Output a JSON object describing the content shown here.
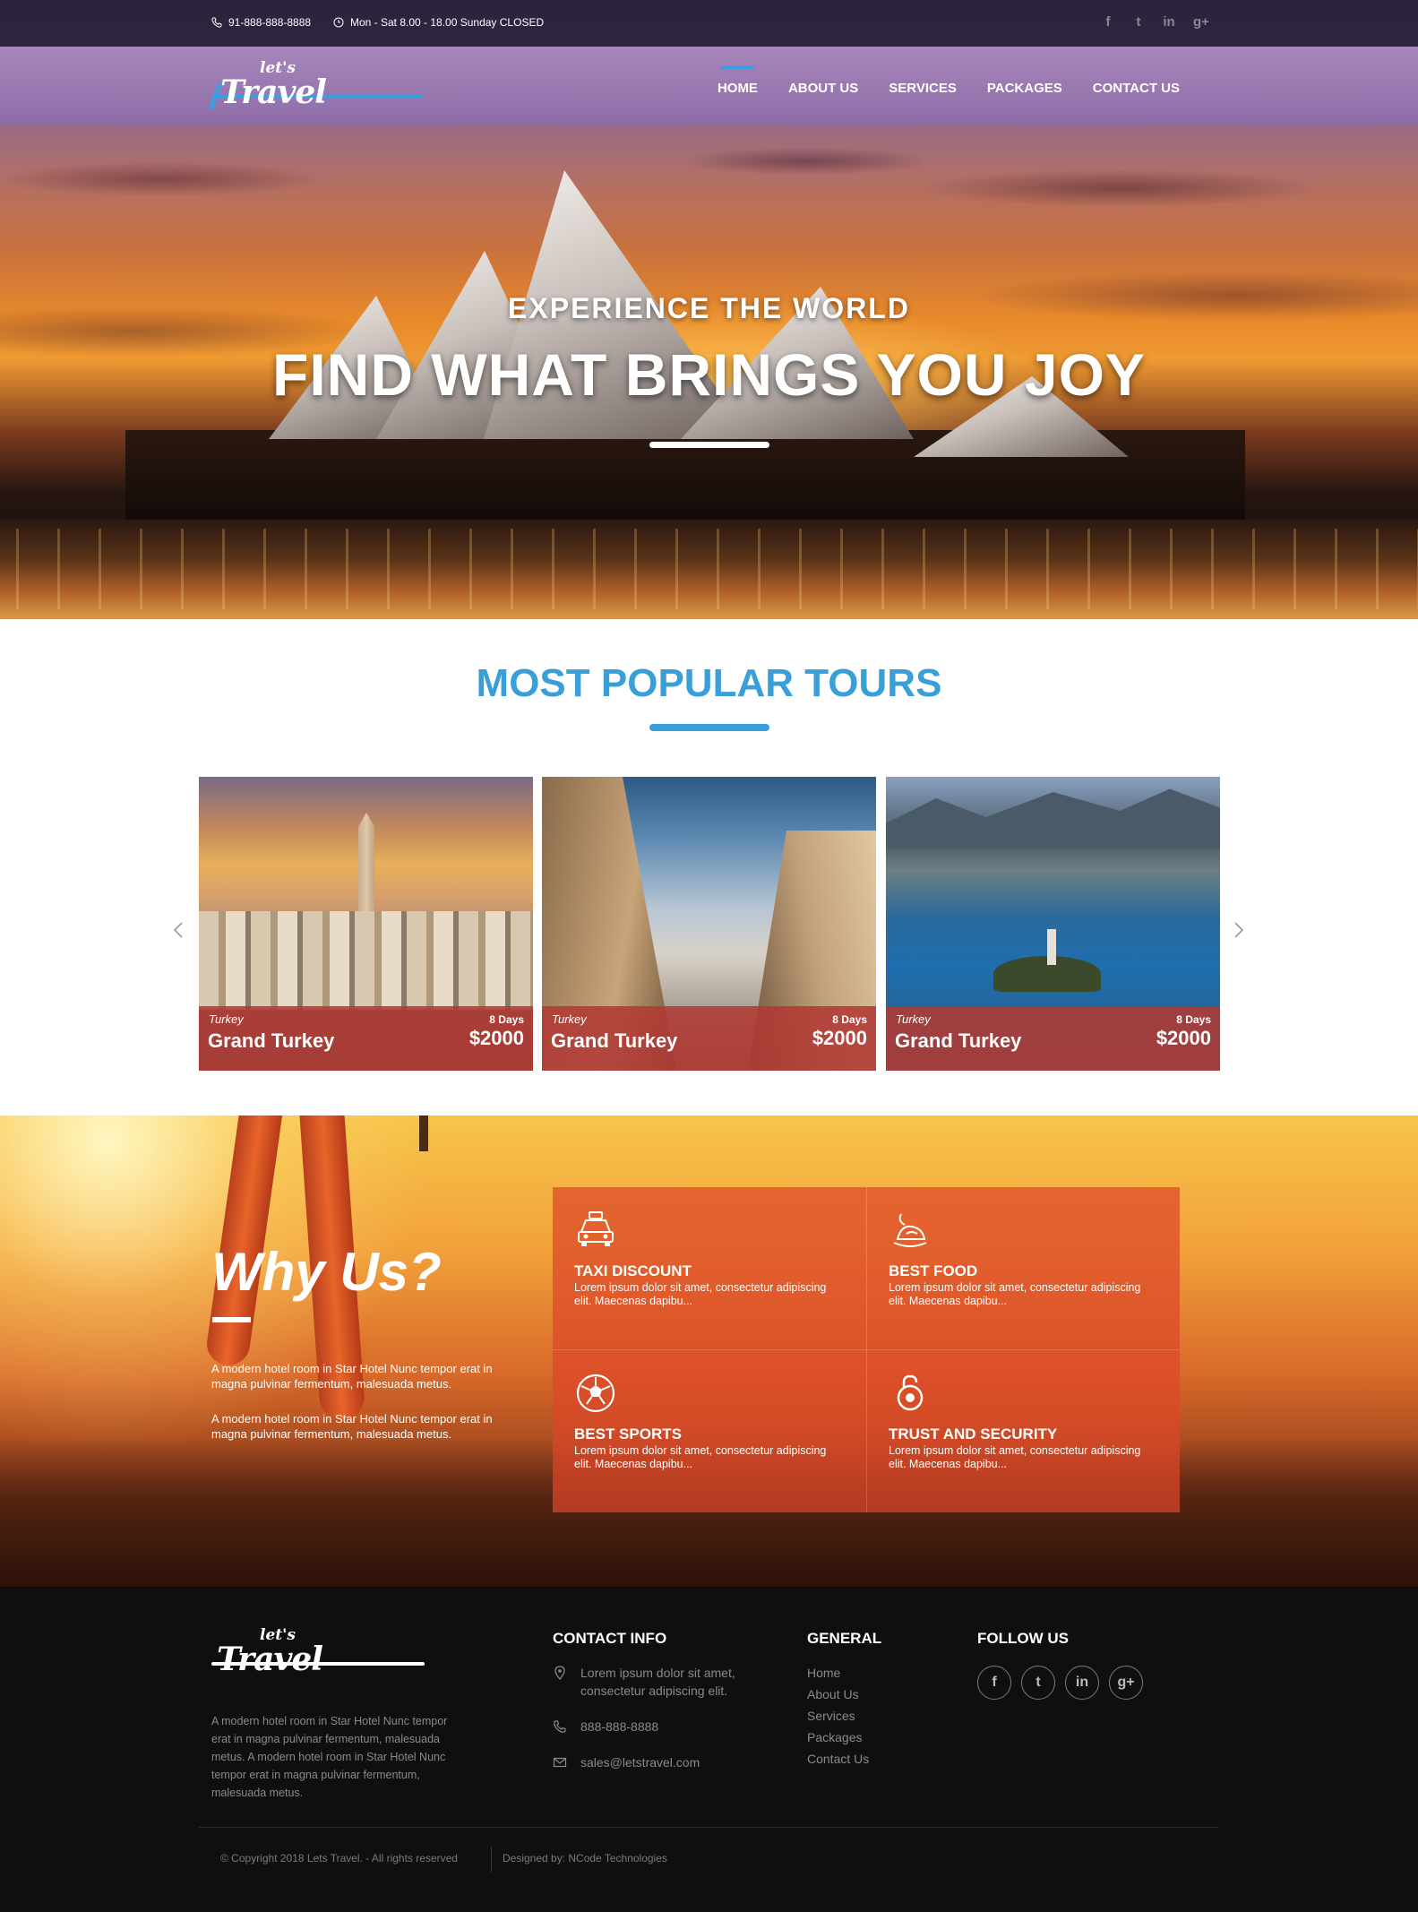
{
  "topbar": {
    "phone": "91-888-888-8888",
    "hours": "Mon - Sat 8.00 - 18.00 Sunday CLOSED",
    "social_icons": [
      "facebook-icon",
      "twitter-icon",
      "linkedin-icon",
      "google-plus-icon"
    ]
  },
  "logo": {
    "small": "let's",
    "big": "Travel"
  },
  "nav": {
    "items": [
      {
        "label": "HOME",
        "active": true
      },
      {
        "label": "ABOUT US",
        "active": false
      },
      {
        "label": "SERVICES",
        "active": false
      },
      {
        "label": "PACKAGES",
        "active": false
      },
      {
        "label": "CONTACT US",
        "active": false
      }
    ]
  },
  "hero": {
    "subtitle": "EXPERIENCE THE WORLD",
    "title": "FIND WHAT BRINGS YOU JOY"
  },
  "tours": {
    "title": "MOST POPULAR TOURS",
    "cards": [
      {
        "country": "Turkey",
        "name": "Grand Turkey",
        "days": "8 Days",
        "price": "$2000"
      },
      {
        "country": "Turkey",
        "name": "Grand Turkey",
        "days": "8 Days",
        "price": "$2000"
      },
      {
        "country": "Turkey",
        "name": "Grand Turkey",
        "days": "8 Days",
        "price": "$2000"
      }
    ]
  },
  "why": {
    "title": "Why Us?",
    "paragraphs": [
      "A modern hotel room in Star Hotel Nunc tempor erat in magna pulvinar fermentum, malesuada metus.",
      "A modern hotel room in Star Hotel Nunc tempor erat in magna pulvinar fermentum, malesuada metus."
    ],
    "features": [
      {
        "title": "TAXI DISCOUNT",
        "text": "Lorem ipsum dolor sit amet, consectetur adipiscing elit. Maecenas dapibu...",
        "icon": "taxi-icon"
      },
      {
        "title": "BEST FOOD",
        "text": "Lorem ipsum dolor sit amet, consectetur adipiscing elit. Maecenas dapibu...",
        "icon": "food-icon"
      },
      {
        "title": "BEST SPORTS",
        "text": "Lorem ipsum dolor sit amet, consectetur adipiscing elit. Maecenas dapibu...",
        "icon": "soccer-ball-icon"
      },
      {
        "title": "TRUST AND SECURITY",
        "text": "Lorem ipsum dolor sit amet, consectetur adipiscing elit. Maecenas dapibu...",
        "icon": "lock-icon"
      }
    ]
  },
  "footer": {
    "about": "A modern hotel room in Star Hotel Nunc tempor erat in magna pulvinar fermentum, malesuada metus. A modern hotel room in Star Hotel Nunc tempor erat in magna pulvinar fermentum, malesuada metus.",
    "contact_heading": "CONTACT INFO",
    "address": "Lorem ipsum dolor sit amet, consectetur adipiscing elit.",
    "phone": "888-888-8888",
    "email": "sales@letstravel.com",
    "general_heading": "GENERAL",
    "general_links": [
      "Home",
      "About Us",
      "Services",
      "Packages",
      "Contact Us"
    ],
    "follow_heading": "FOLLOW US",
    "copyright": "© Copyright 2018 Lets Travel. - All rights reserved",
    "designed_by": "Designed by: NCode Technologies"
  },
  "colors": {
    "accent_blue": "#3a9fd9",
    "card_caption": "#b03a34",
    "feature_panel": "#dc4628",
    "footer_bg": "#0f0f0f"
  }
}
